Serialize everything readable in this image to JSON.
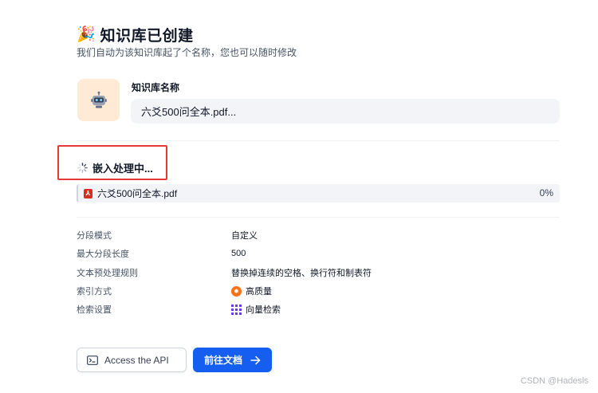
{
  "header": {
    "title": "知识库已创建",
    "subtitle": "我们自动为该知识库起了个名称，您也可以随时修改"
  },
  "knowledge_base": {
    "name_label": "知识库名称",
    "name_value": "六爻500问全本.pdf..."
  },
  "embedding": {
    "status_text": "嵌入处理中...",
    "files": [
      {
        "name": "六爻500问全本.pdf",
        "progress": "0%"
      }
    ]
  },
  "settings": [
    {
      "label": "分段模式",
      "value": "自定义"
    },
    {
      "label": "最大分段长度",
      "value": "500"
    },
    {
      "label": "文本预处理规则",
      "value": "替换掉连续的空格、换行符和制表符"
    },
    {
      "label": "索引方式",
      "value": "高质量",
      "icon": "high-quality-icon"
    },
    {
      "label": "检索设置",
      "value": "向量检索",
      "icon": "vector-search-icon"
    }
  ],
  "actions": {
    "api_label": "Access the API",
    "docs_label": "前往文档"
  },
  "watermark": "CSDN @Hadesls",
  "colors": {
    "primary": "#155eef",
    "highlight_box": "#e53935",
    "avatar_bg": "#ffead5"
  }
}
